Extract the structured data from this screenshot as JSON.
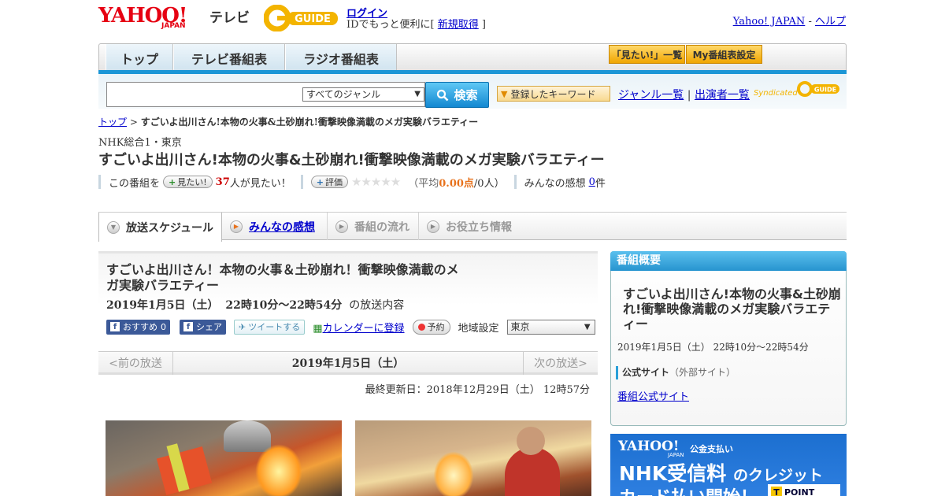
{
  "header": {
    "logo_text": "YAHOO!",
    "logo_sub": "JAPAN",
    "service": "テレビ",
    "gguide": "G-GUIDE",
    "login": "ログイン",
    "login_sub_prefix": "IDでもっと便利に[ ",
    "signup": "新規取得",
    "login_sub_suffix": " ]",
    "yahoo_japan": "Yahoo! JAPAN",
    "dash": " - ",
    "help": "ヘルプ"
  },
  "nav": {
    "tabs": [
      {
        "label": "トップ"
      },
      {
        "label": "テレビ番組表"
      },
      {
        "label": "ラジオ番組表"
      }
    ],
    "want_list": "「見たい!」一覧",
    "my_schedule": "My番組表設定"
  },
  "search": {
    "genre": "すべてのジャンル",
    "button": "検索",
    "keyword_btn": "登録したキーワード",
    "genre_list": "ジャンル一覧",
    "divider": " | ",
    "cast_list": "出演者一覧",
    "syndicated": "Syndicated"
  },
  "breadcrumb": {
    "top": "トップ",
    "sep": " > ",
    "current": "すごいよ出川さん!本物の火事&土砂崩れ!衝撃映像満載のメガ実験バラエティー"
  },
  "program": {
    "channel": "NHK総合1・東京",
    "title": "すごいよ出川さん!本物の火事&土砂崩れ!衝撃映像満載のメガ実験バラエティー",
    "this_program": "この番組を",
    "want_btn": "見たい!",
    "want_count": "37",
    "want_suffix": "人が見たい！",
    "rate_btn": "評価",
    "avg_label": "（平均",
    "avg_value": "0.00点",
    "avg_people": "/0人）",
    "impressions_label": "みんなの感想",
    "impressions_count": "0",
    "impressions_unit": "件",
    "rating_stars": 0
  },
  "tabs": [
    {
      "label": "放送スケジュール",
      "state": "active"
    },
    {
      "label": "みんなの感想",
      "state": "link"
    },
    {
      "label": "番組の流れ",
      "state": "disabled"
    },
    {
      "label": "お役立ち情報",
      "state": "disabled"
    }
  ],
  "schedule": {
    "title": "すごいよ出川さん！本物の火事＆土砂崩れ！衝撃映像満載のメガ実験バラエティー",
    "date": "2019年1月5日（土）",
    "time": "22時10分～22時54分",
    "suffix": "の放送内容",
    "recommend": "おすすめ",
    "recommend_count": "0",
    "share": "シェア",
    "tweet": "ツイートする",
    "calendar": "カレンダーに登録",
    "reserve": "予約",
    "region_label": "地域設定",
    "region": "東京",
    "prev": "<前の放送",
    "day": "2019年1月5日（土）",
    "next": "次の放送>",
    "updated": "最終更新日：2018年12月29日（土）  12時57分"
  },
  "sidebar": {
    "head": "番組概要",
    "title": "すごいよ出川さん!本物の火事&土砂崩れ!衝撃映像満載のメガ実験バラエティー",
    "time": "2019年1月5日（土）  22時10分～22時54分",
    "official": "公式サイト",
    "external": "（外部サイト）",
    "official_link": "番組公式サイト"
  },
  "banner": {
    "logo": "YAHOO!",
    "logo_sub": "JAPAN",
    "service": "公金支払い",
    "main_a": "NHK受信料",
    "main_b": "のクレジット",
    "sub": "カード払い開始！",
    "tpoint": "POINT"
  },
  "colors": {
    "brand_red": "#e60012",
    "accent_blue": "#1b96d6",
    "link": "#0000cc"
  }
}
